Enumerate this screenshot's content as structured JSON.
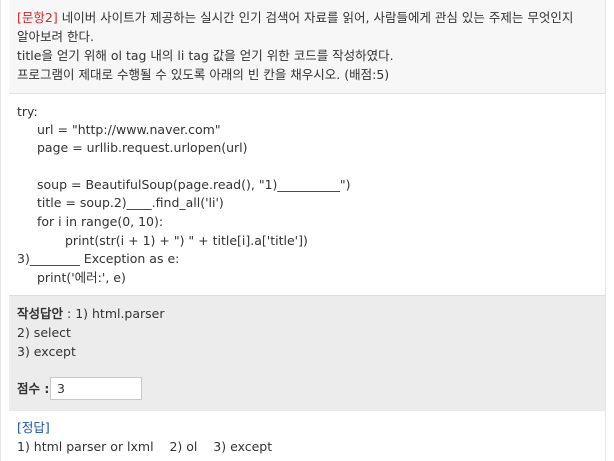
{
  "question": {
    "number_label": "[문항2]",
    "line1_rest": " 네이버 사이트가 제공하는 실시간 인기 검색어 자료를 읽어, 사람들에게 관심 있는 주제는 무엇인지",
    "line2": "알아보려 한다.",
    "line3": "title을 얻기 위해 ol tag 내의 li tag 값을 얻기 위한 코드를 작성하였다.",
    "line4": "프로그램이 제대로 수행될 수 있도록 아래의 빈 칸을 채우시오. (배점:5)"
  },
  "code": {
    "lines": [
      "try:",
      "url = \"http://www.naver.com\"",
      "page = urllib.request.urlopen(url)",
      "soup = BeautifulSoup(page.read(), \"1)__________\")",
      "title = soup.2)____.find_all('li')",
      "for i in range(0, 10):",
      "print(str(i + 1) + \") \" + title[i].a['title'])",
      "3)________ Exception as e:",
      "print('에러:', e)"
    ]
  },
  "answer": {
    "label": "작성답안",
    "separator": " : ",
    "line1": "1) html.parser",
    "line2": "2) select",
    "line3": "3) except",
    "score_label": "점수 :",
    "score_value": "3"
  },
  "correct": {
    "title": "[정답]",
    "answer": "1) html parser or lxml    2) ol    3) except"
  }
}
